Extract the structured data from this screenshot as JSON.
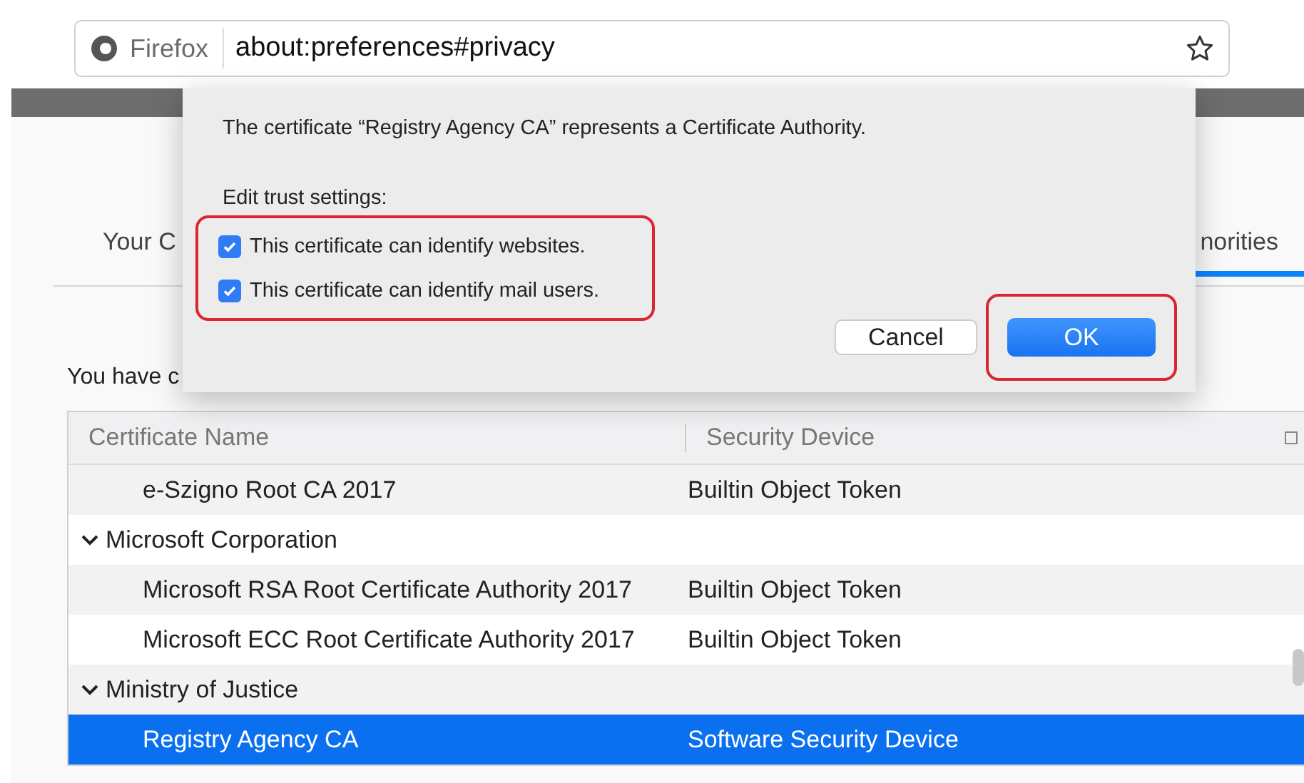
{
  "browser": {
    "brand": "Firefox",
    "url": "about:preferences#privacy"
  },
  "page": {
    "tabs": [
      {
        "label": "Your C",
        "selected": false
      },
      {
        "label": "norities",
        "selected": true
      }
    ],
    "intro": "You have c"
  },
  "table": {
    "columns": [
      "Certificate Name",
      "Security Device"
    ],
    "rows": [
      {
        "kind": "cert",
        "name": "e-Szigno Root CA 2017",
        "device": "Builtin Object Token",
        "selected": false
      },
      {
        "kind": "group",
        "name": "Microsoft Corporation",
        "expanded": true,
        "children": [
          {
            "kind": "cert",
            "name": "Microsoft RSA Root Certificate Authority 2017",
            "device": "Builtin Object Token",
            "selected": false
          },
          {
            "kind": "cert",
            "name": "Microsoft ECC Root Certificate Authority 2017",
            "device": "Builtin Object Token",
            "selected": false
          }
        ]
      },
      {
        "kind": "group",
        "name": "Ministry of Justice",
        "expanded": true,
        "children": [
          {
            "kind": "cert",
            "name": "Registry Agency CA",
            "device": "Software Security Device",
            "selected": true
          }
        ]
      }
    ]
  },
  "dialog": {
    "message": "The certificate “Registry Agency CA” represents a Certificate Authority.",
    "heading": "Edit trust settings:",
    "options": [
      {
        "label": "This certificate can identify websites.",
        "checked": true
      },
      {
        "label": "This certificate can identify mail users.",
        "checked": true
      }
    ],
    "buttons": [
      {
        "label": "Cancel",
        "kind": "secondary"
      },
      {
        "label": "OK",
        "kind": "primary"
      }
    ]
  }
}
